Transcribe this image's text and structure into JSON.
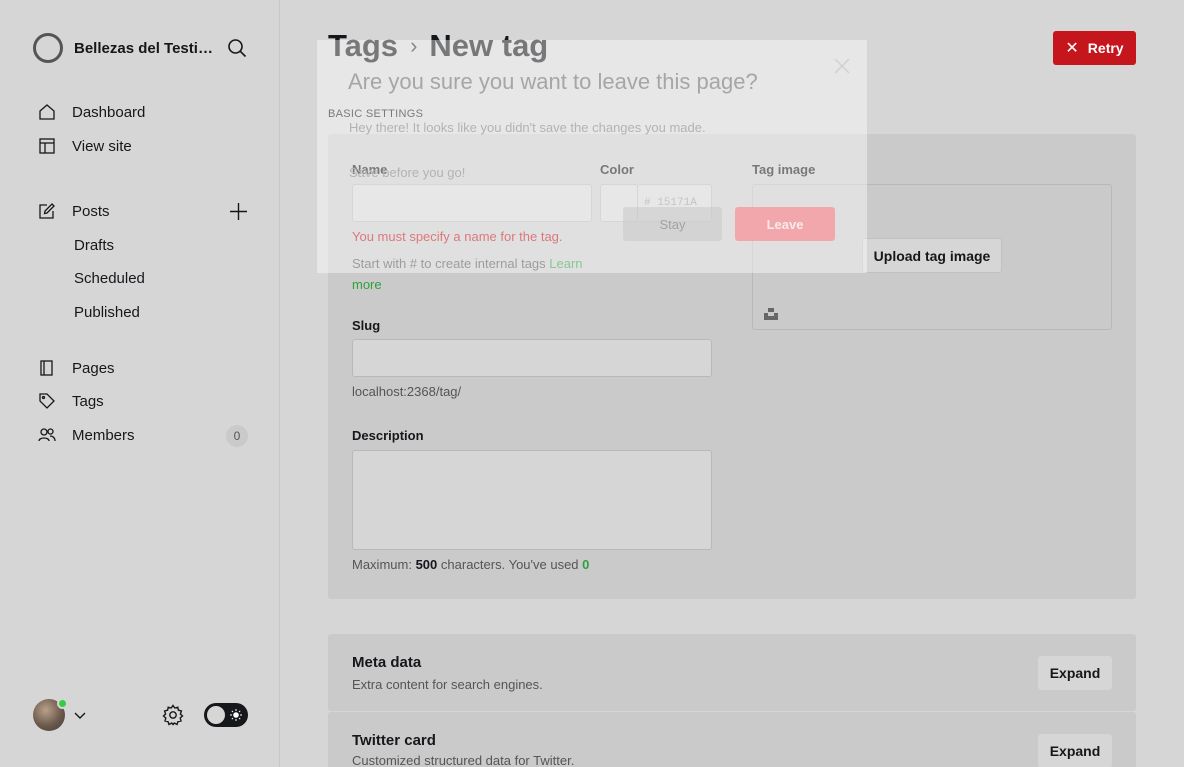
{
  "sidebar": {
    "site_name": "Bellezas del Testing",
    "items": [
      {
        "label": "Dashboard",
        "icon": "home-icon"
      },
      {
        "label": "View site",
        "icon": "layout-icon"
      },
      {
        "label": "Posts",
        "icon": "edit-icon"
      },
      {
        "label": "Pages",
        "icon": "page-icon"
      },
      {
        "label": "Tags",
        "icon": "tag-icon"
      },
      {
        "label": "Members",
        "icon": "members-icon"
      }
    ],
    "post_subitems": [
      "Drafts",
      "Scheduled",
      "Published"
    ],
    "members_count": "0"
  },
  "header": {
    "breadcrumb_parent": "Tags",
    "breadcrumb_current": "New tag",
    "retry_label": "Retry"
  },
  "form": {
    "section_label": "BASIC SETTINGS",
    "name_label": "Name",
    "name_value": "",
    "name_error": "You must specify a name for the tag.",
    "name_hint": "Start with # to create internal tags",
    "name_hint_link": "Learn more",
    "color_label": "Color",
    "color_value": "15171A",
    "color_prefix": "#",
    "image_label": "Tag image",
    "upload_label": "Upload tag image",
    "slug_label": "Slug",
    "slug_value": "",
    "slug_hint": "localhost:2368/tag/",
    "description_label": "Description",
    "description_value": "",
    "desc_hint_prefix": "Maximum:",
    "desc_max": "500",
    "desc_hint_mid": "characters. You've used",
    "desc_used": "0"
  },
  "sections": [
    {
      "title": "Meta data",
      "subtitle": "Extra content for search engines.",
      "button": "Expand"
    },
    {
      "title": "Twitter card",
      "subtitle": "Customized structured data for Twitter.",
      "button": "Expand"
    }
  ],
  "modal": {
    "title": "Are you sure you want to leave this page?",
    "body_line1": "Hey there! It looks like you didn't save the changes you made.",
    "body_line2": "Save before you go!",
    "stay_label": "Stay",
    "leave_label": "Leave"
  },
  "colors": {
    "accent_red": "#c5161d",
    "link_green": "#30a03e",
    "status_online": "#30cf43"
  }
}
